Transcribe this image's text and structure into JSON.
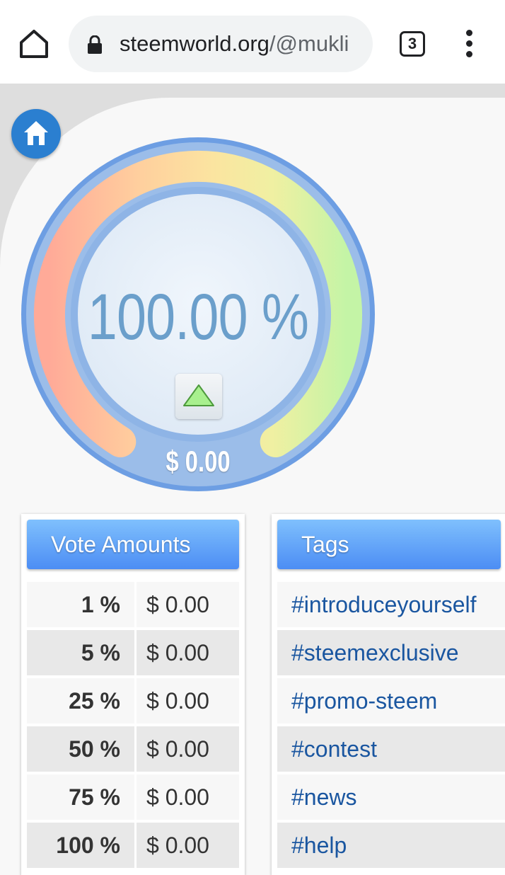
{
  "browser": {
    "url_host": "steemworld.org",
    "url_path": "/@mukli",
    "tab_count": "3"
  },
  "gauge": {
    "percent_text": "100.00 %",
    "percent_value": 100.0,
    "vote_value": "$ 0.00"
  },
  "vote_amounts": {
    "title": "Vote Amounts",
    "rows": [
      {
        "pct": "1 %",
        "amount": "$ 0.00"
      },
      {
        "pct": "5 %",
        "amount": "$ 0.00"
      },
      {
        "pct": "25 %",
        "amount": "$ 0.00"
      },
      {
        "pct": "50 %",
        "amount": "$ 0.00"
      },
      {
        "pct": "75 %",
        "amount": "$ 0.00"
      },
      {
        "pct": "100 %",
        "amount": "$ 0.00"
      }
    ]
  },
  "tags": {
    "title": "Tags",
    "items": [
      "#introduceyourself",
      "#steemexclusive",
      "#promo-steem",
      "#contest",
      "#news",
      "#help"
    ]
  },
  "colors": {
    "accent_blue": "#4c8df4",
    "tag_link": "#1a56a0",
    "gauge_text": "#6b9fcb"
  }
}
